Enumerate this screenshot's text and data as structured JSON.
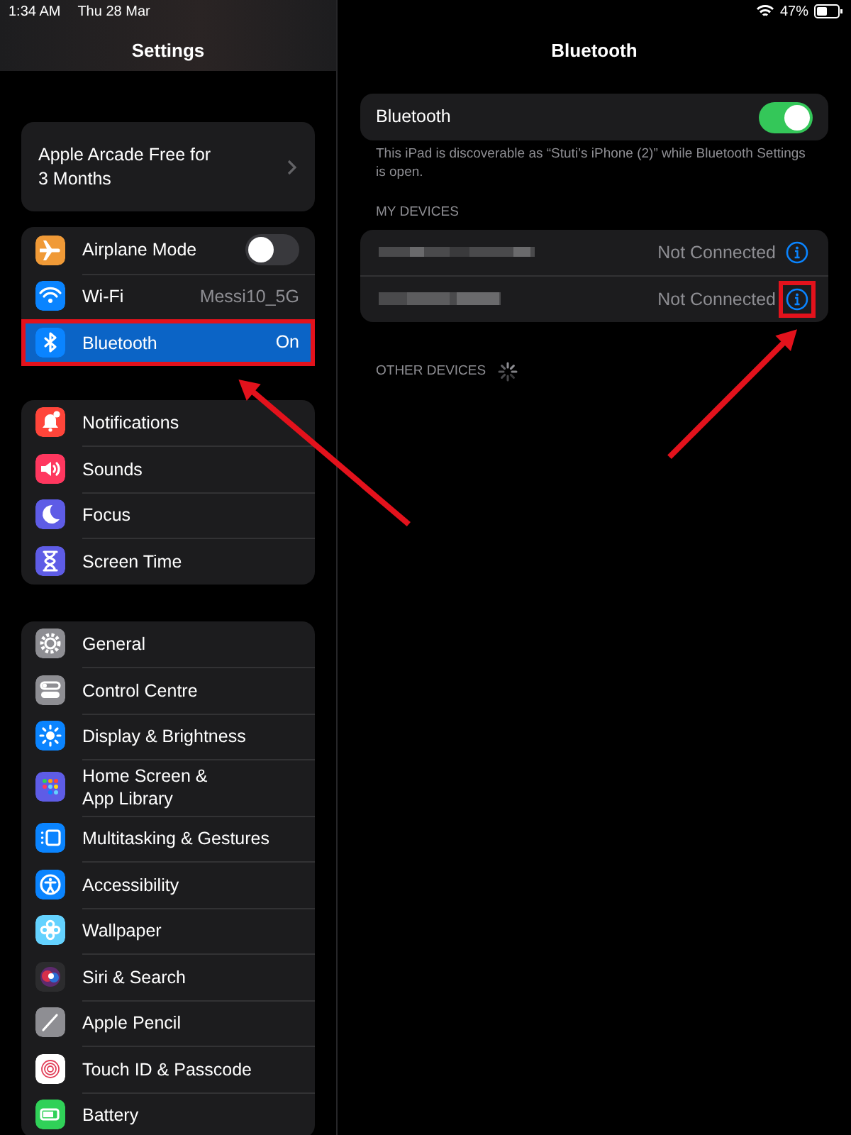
{
  "status_bar": {
    "time": "1:34 AM",
    "date": "Thu 28 Mar",
    "battery": "47%"
  },
  "sidebar": {
    "title": "Settings",
    "promo": {
      "label": "Apple Arcade Free for\n3 Months"
    },
    "groups": [
      {
        "items": [
          {
            "label": "Airplane Mode",
            "kind": "toggle",
            "on": false,
            "selected": false,
            "highlighted": false,
            "color": "#f09a37"
          },
          {
            "label": "Wi-Fi",
            "kind": "value",
            "value": "Messi10_5G",
            "selected": false,
            "highlighted": false,
            "color": "#0a84ff"
          },
          {
            "label": "Bluetooth",
            "kind": "value",
            "value": "On",
            "selected": true,
            "highlighted": true,
            "color": "#0a84ff"
          }
        ]
      },
      {
        "items": [
          {
            "label": "Notifications",
            "kind": "link",
            "selected": false,
            "highlighted": false,
            "color": "#ff453a"
          },
          {
            "label": "Sounds",
            "kind": "link",
            "selected": false,
            "highlighted": false,
            "color": "#ff375f"
          },
          {
            "label": "Focus",
            "kind": "link",
            "selected": false,
            "highlighted": false,
            "color": "#5e5ce6"
          },
          {
            "label": "Screen Time",
            "kind": "link",
            "selected": false,
            "highlighted": false,
            "color": "#5e5ce6"
          }
        ]
      },
      {
        "items": [
          {
            "label": "General",
            "kind": "link",
            "selected": false,
            "highlighted": false,
            "color": "#8e8e93"
          },
          {
            "label": "Control Centre",
            "kind": "link",
            "selected": false,
            "highlighted": false,
            "color": "#8e8e93"
          },
          {
            "label": "Display & Brightness",
            "kind": "link",
            "selected": false,
            "highlighted": false,
            "color": "#0a84ff"
          },
          {
            "label": "Home Screen &\nApp Library",
            "kind": "link",
            "selected": false,
            "highlighted": false,
            "color": "#5e5ce6"
          },
          {
            "label": "Multitasking & Gestures",
            "kind": "link",
            "selected": false,
            "highlighted": false,
            "color": "#0a84ff"
          },
          {
            "label": "Accessibility",
            "kind": "link",
            "selected": false,
            "highlighted": false,
            "color": "#0a84ff"
          },
          {
            "label": "Wallpaper",
            "kind": "link",
            "selected": false,
            "highlighted": false,
            "color": "#64d2ff"
          },
          {
            "label": "Siri & Search",
            "kind": "link",
            "selected": false,
            "highlighted": false,
            "color": "#2c2c2e"
          },
          {
            "label": "Apple Pencil",
            "kind": "link",
            "selected": false,
            "highlighted": false,
            "color": "#8e8e93"
          },
          {
            "label": "Touch ID & Passcode",
            "kind": "link",
            "selected": false,
            "highlighted": false,
            "color": "#ffffff"
          },
          {
            "label": "Battery",
            "kind": "link",
            "selected": false,
            "highlighted": false,
            "color": "#30d158"
          }
        ]
      }
    ]
  },
  "detail": {
    "title": "Bluetooth",
    "toggle": {
      "label": "Bluetooth",
      "on": true
    },
    "note": "This iPad is discoverable as “Stuti’s iPhone (2)” while Bluetooth Settings is open.",
    "my_devices": {
      "header": "MY DEVICES",
      "devices": [
        {
          "status": "Not Connected",
          "highlighted": false
        },
        {
          "status": "Not Connected",
          "highlighted": true
        }
      ]
    },
    "other_devices": {
      "header": "OTHER DEVICES",
      "searching": true
    }
  }
}
